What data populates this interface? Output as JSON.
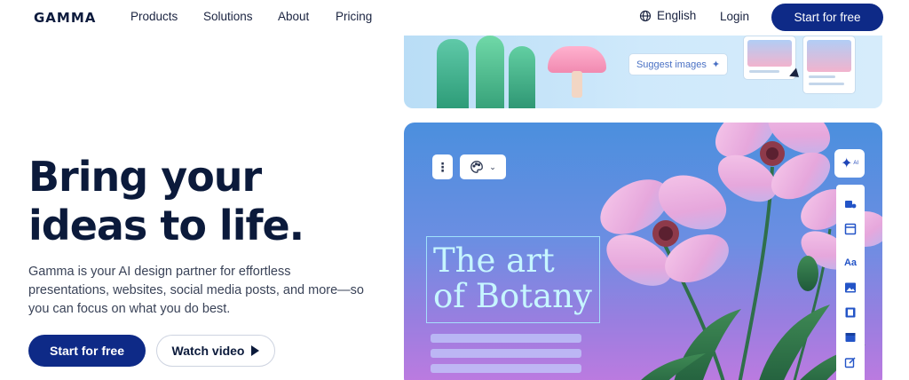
{
  "nav": {
    "logo": "GAMMA",
    "links": [
      "Products",
      "Solutions",
      "About",
      "Pricing"
    ],
    "language": "English",
    "login": "Login",
    "cta": "Start for free"
  },
  "hero": {
    "headline": "Bring your ideas to life.",
    "subcopy": "Gamma is your AI design partner for effortless presentations, websites, social media posts, and more—so you can focus on what you do best.",
    "primary_cta": "Start for free",
    "secondary_cta": "Watch video"
  },
  "preview": {
    "suggest_button": "Suggest images",
    "slide_title_line1": "The art",
    "slide_title_line2": "of Botany",
    "ai_badge": "AI",
    "toolbar_text_icon": "Aa"
  },
  "colors": {
    "brand": "#0e2a87",
    "text": "#0b1a3b",
    "slide_title": "#c6f6ff"
  },
  "icons": [
    "globe-icon",
    "play-icon",
    "sparkle-icon",
    "more-vertical-icon",
    "palette-icon",
    "chevron-down-icon",
    "cursor-icon"
  ]
}
